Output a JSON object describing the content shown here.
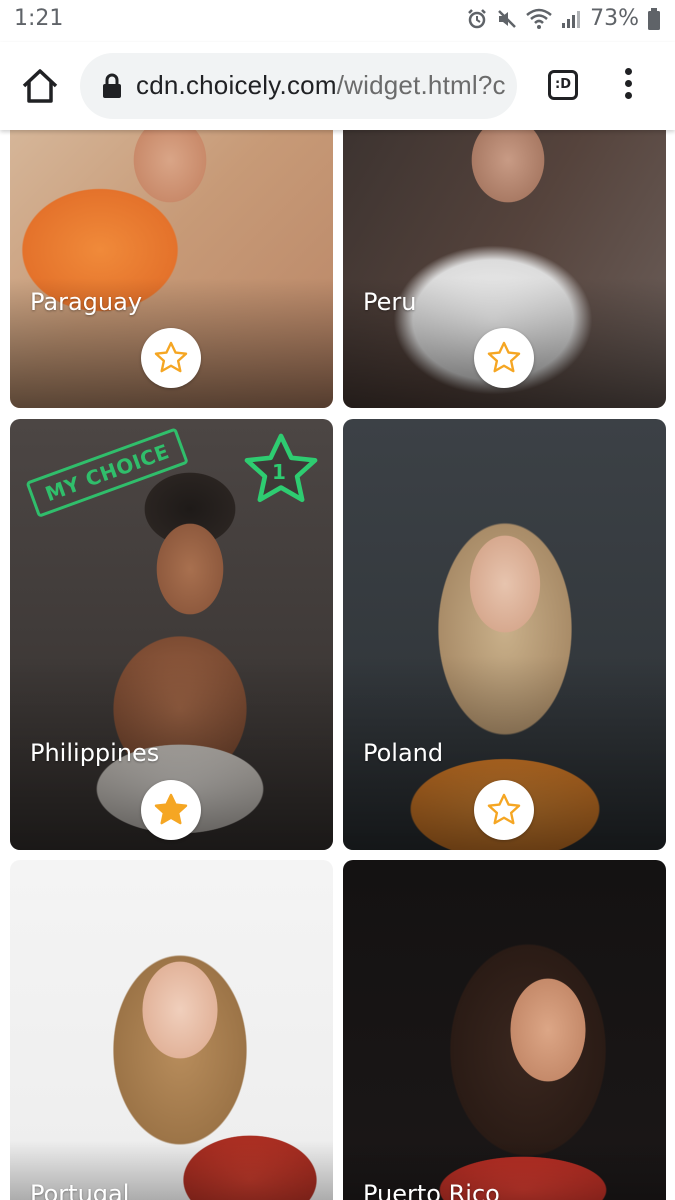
{
  "status_bar": {
    "time": "1:21",
    "battery": "73%"
  },
  "browser": {
    "url_host": "cdn.choicely.com",
    "url_path": "/widget.html?c",
    "tab_label": ":D"
  },
  "cards": [
    {
      "name": "Paraguay",
      "starred": false
    },
    {
      "name": "Peru",
      "starred": false
    },
    {
      "name": "Philippines",
      "starred": true,
      "badge": "MY CHOICE",
      "rank": "1"
    },
    {
      "name": "Poland",
      "starred": false
    },
    {
      "name": "Portugal",
      "starred": false
    },
    {
      "name": "Puerto Rico",
      "starred": false
    }
  ],
  "colors": {
    "star_outline": "#f5a623",
    "star_fill": "#f5a623",
    "choice_green": "#2ecc71"
  }
}
